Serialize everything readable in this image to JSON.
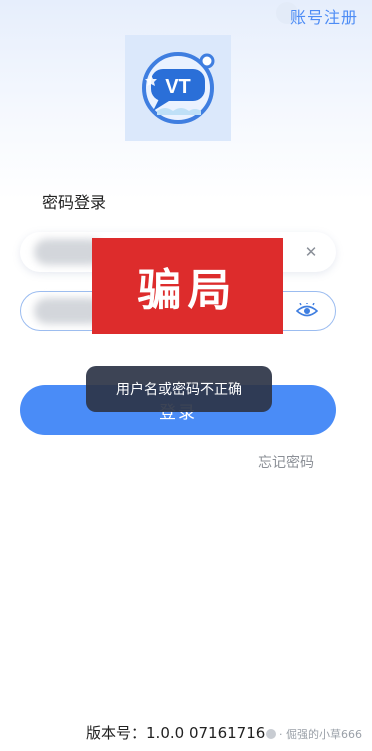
{
  "header": {
    "register_label": "账号注册"
  },
  "logo": {
    "text": "VT"
  },
  "login": {
    "title": "密码登录",
    "clear_icon": "close-icon",
    "eye_icon": "eye-icon",
    "button_label": "登录"
  },
  "overlay": {
    "stamp_text": "骗局",
    "toast_text": "用户名或密码不正确"
  },
  "forgot_label": "忘记密码",
  "footer": {
    "version_label": "版本号：",
    "version_value": "1.0.0 07161716",
    "watermark": "· 倔强的小草666"
  }
}
